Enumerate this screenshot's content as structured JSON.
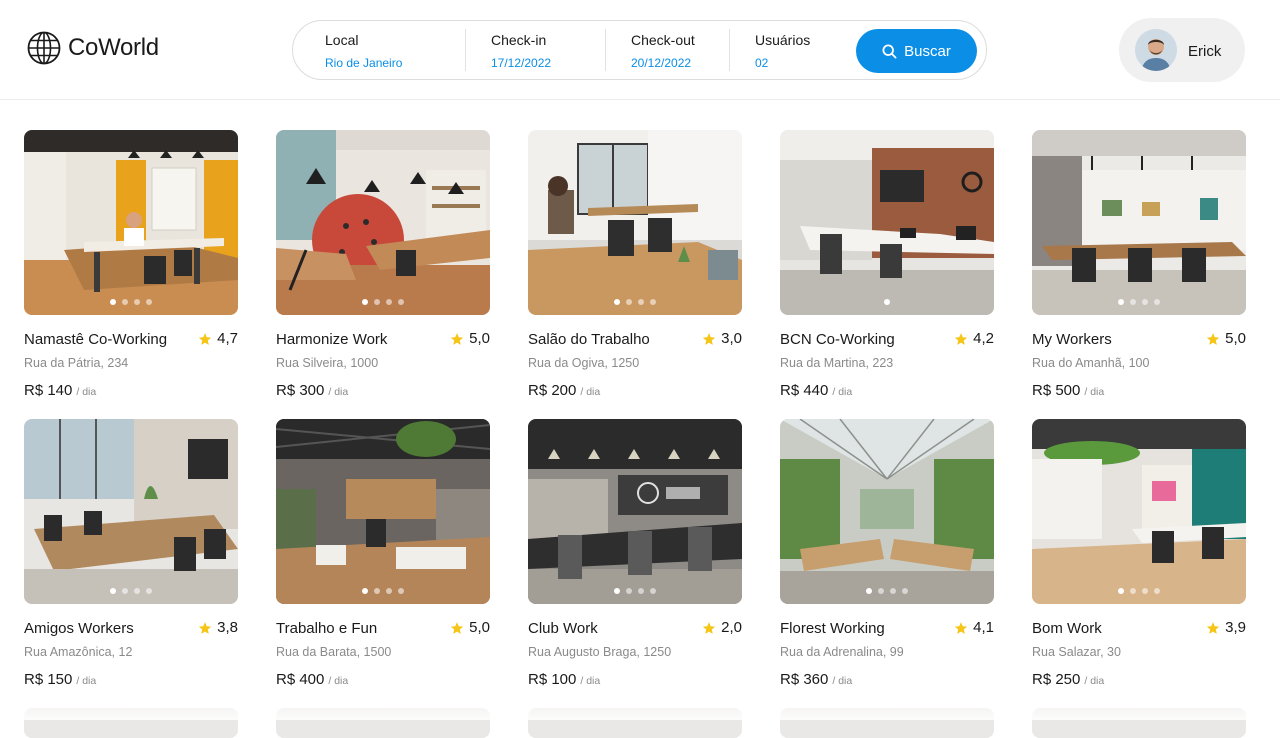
{
  "app": {
    "logo_text": "CoWorld"
  },
  "search": {
    "local": {
      "label": "Local",
      "value": "Rio de Janeiro"
    },
    "checkin": {
      "label": "Check-in",
      "value": "17/12/2022"
    },
    "checkout": {
      "label": "Check-out",
      "value": "20/12/2022"
    },
    "users": {
      "label": "Usuários",
      "value": "02"
    },
    "button_label": "Buscar",
    "accent_color": "#0a8ee6"
  },
  "user": {
    "name": "Erick"
  },
  "listings": [
    {
      "title": "Namastê Co-Working",
      "rating": "4,7",
      "address": "Rua da Pátria, 234",
      "price": "R$ 140",
      "per": "/ dia",
      "photo_icon": "office-photo-yellow-walls",
      "active_dot": 0
    },
    {
      "title": "Harmonize Work",
      "rating": "5,0",
      "address": "Rua Silveira, 1000",
      "price": "R$ 300",
      "per": "/ dia",
      "photo_icon": "office-photo-wood-desks",
      "active_dot": 0
    },
    {
      "title": "Salão do Trabalho",
      "rating": "3,0",
      "address": "Rua da Ogiva, 1250",
      "price": "R$ 200",
      "per": "/ dia",
      "photo_icon": "office-photo-white-room",
      "active_dot": 0
    },
    {
      "title": "BCN Co-Working",
      "rating": "4,2",
      "address": "Rua da Martina, 223",
      "price": "R$ 440",
      "per": "/ dia",
      "photo_icon": "office-photo-brick-wall",
      "active_dot": 0
    },
    {
      "title": "My Workers",
      "rating": "5,0",
      "address": "Rua do Amanhã, 100",
      "price": "R$ 500",
      "per": "/ dia",
      "photo_icon": "office-photo-white-brick",
      "active_dot": 0
    },
    {
      "title": "Amigos Workers",
      "rating": "3,8",
      "address": "Rua Amazônica, 12",
      "price": "R$ 150",
      "per": "/ dia",
      "photo_icon": "meeting-room-photo",
      "active_dot": 0
    },
    {
      "title": "Trabalho e Fun",
      "rating": "5,0",
      "address": "Rua da Barata, 1500",
      "price": "R$ 400",
      "per": "/ dia",
      "photo_icon": "open-office-photo-plants",
      "active_dot": 0
    },
    {
      "title": "Club Work",
      "rating": "2,0",
      "address": "Rua Augusto Braga, 1250",
      "price": "R$ 100",
      "per": "/ dia",
      "photo_icon": "office-photo-chalkboard",
      "active_dot": 0
    },
    {
      "title": "Florest Working",
      "rating": "4,1",
      "address": "Rua da Adrenalina, 99",
      "price": "R$ 360",
      "per": "/ dia",
      "photo_icon": "greenhouse-office-photo",
      "active_dot": 0
    },
    {
      "title": "Bom Work",
      "rating": "3,9",
      "address": "Rua Salazar, 30",
      "price": "R$ 250",
      "per": "/ dia",
      "photo_icon": "office-photo-teal-wall",
      "active_dot": 0
    }
  ],
  "colors": {
    "star": "#f5c518",
    "accent": "#0a8ee6",
    "muted_text": "#8a8a8a"
  }
}
